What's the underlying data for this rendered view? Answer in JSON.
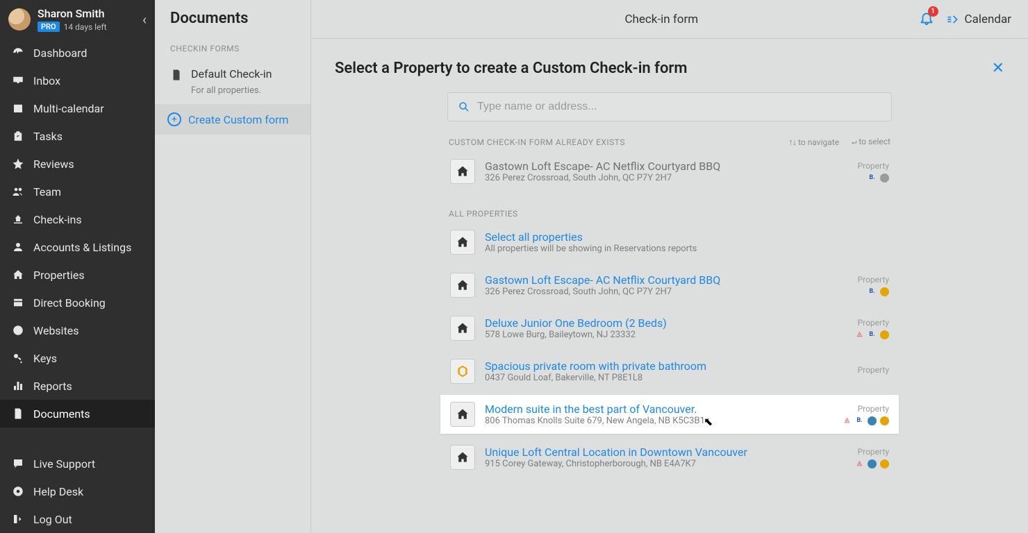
{
  "profile": {
    "name": "Sharon Smith",
    "badge": "PRO",
    "days": "14 days left"
  },
  "nav": [
    {
      "label": "Dashboard",
      "icon": "dashboard"
    },
    {
      "label": "Inbox",
      "icon": "inbox"
    },
    {
      "label": "Multi-calendar",
      "icon": "multicalendar"
    },
    {
      "label": "Tasks",
      "icon": "tasks"
    },
    {
      "label": "Reviews",
      "icon": "star"
    },
    {
      "label": "Team",
      "icon": "team"
    },
    {
      "label": "Check-ins",
      "icon": "checkins"
    },
    {
      "label": "Accounts & Listings",
      "icon": "accounts"
    },
    {
      "label": "Properties",
      "icon": "properties"
    },
    {
      "label": "Direct Booking",
      "icon": "directbooking"
    },
    {
      "label": "Websites",
      "icon": "websites"
    },
    {
      "label": "Keys",
      "icon": "keys"
    },
    {
      "label": "Reports",
      "icon": "reports"
    },
    {
      "label": "Documents",
      "icon": "documents",
      "active": true
    }
  ],
  "nav_footer": [
    {
      "label": "Live Support",
      "icon": "chat"
    },
    {
      "label": "Help Desk",
      "icon": "help"
    },
    {
      "label": "Log Out",
      "icon": "logout"
    }
  ],
  "panel": {
    "title": "Documents",
    "section_label": "CHECKIN FORMS",
    "default_item": {
      "title": "Default Check-in",
      "sub": "For all properties."
    },
    "create_label": "Create Custom form"
  },
  "topbar": {
    "title": "Check-in form",
    "calendar_label": "Calendar",
    "notification_count": "1"
  },
  "content": {
    "heading": "Select a Property to create a Custom Check-in form",
    "search_placeholder": "Type name or address...",
    "exists_label": "CUSTOM CHECK-IN FORM ALREADY EXISTS",
    "navigate_hint": "to navigate",
    "select_hint": "to select",
    "all_label": "ALL PROPERTIES",
    "exists_property": {
      "title": "Gastown Loft Escape- AC Netflix Courtyard BBQ",
      "address": "326 Perez Crossroad, South John, QC P7Y 2H7",
      "tag": "Property",
      "sources": [
        "b",
        "dot"
      ]
    },
    "select_all": {
      "title": "Select all properties",
      "sub": "All properties will be showing in Reservations reports"
    },
    "properties": [
      {
        "title": "Gastown Loft Escape- AC Netflix Courtyard BBQ",
        "address": "326 Perez Crossroad, South John, QC P7Y 2H7",
        "tag": "Property",
        "sources": [
          "b",
          "gold"
        ]
      },
      {
        "title": "Deluxe Junior One Bedroom (2 Beds)",
        "address": "578 Lowe Burg, Baileytown, NJ 23332",
        "tag": "Property",
        "sources": [
          "air",
          "b",
          "gold"
        ]
      },
      {
        "title": "Spacious private room with private bathroom",
        "address": "0437 Gould Loaf, Bakerville, NT P8E1L8",
        "tag": "Property",
        "sources": [],
        "icon": "token"
      },
      {
        "title": "Modern suite in the best part of Vancouver.",
        "address": "806 Thomas Knolls Suite 679, New Angela, NB K5C3B1",
        "tag": "Property",
        "sources": [
          "air",
          "b",
          "tripadv",
          "gold"
        ],
        "highlight": true
      },
      {
        "title": "Unique Loft Central Location in Downtown Vancouver",
        "address": "915 Corey Gateway, Christopherborough, NB E4A7K7",
        "tag": "Property",
        "sources": [
          "air",
          "tripadv",
          "gold"
        ]
      }
    ]
  }
}
